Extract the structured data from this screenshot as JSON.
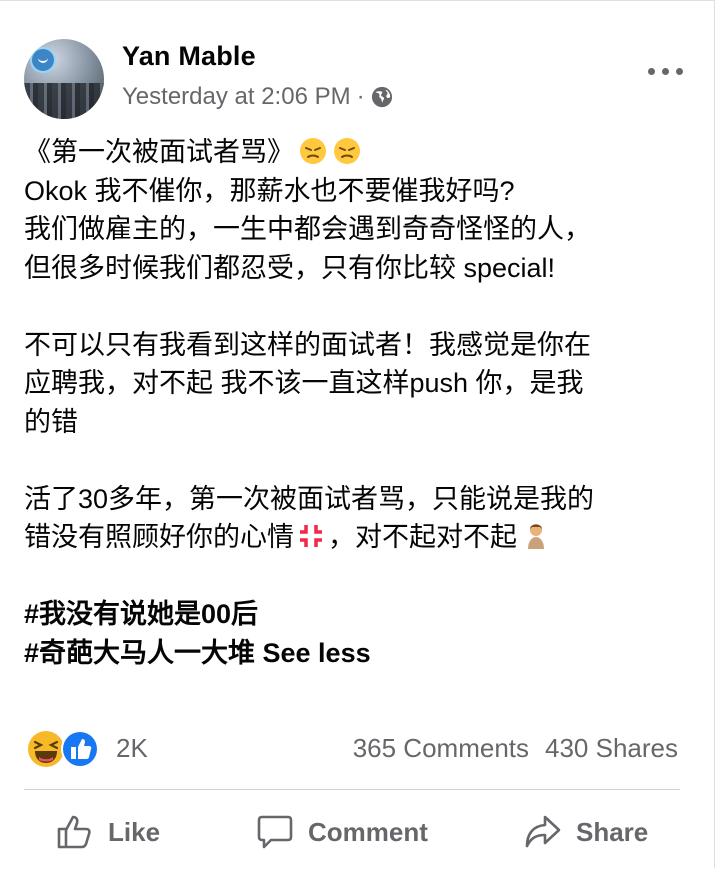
{
  "post": {
    "author": "Yan Mable",
    "timestamp": "Yesterday at 2:06 PM",
    "separator": "·",
    "audience_icon": "globe-icon",
    "more_icon": "more-options-icon",
    "lines": {
      "l1": "《第一次被面试者骂》",
      "l2": "Okok 我不催你，那薪水也不要催我好吗?",
      "l3": "我们做雇主的，一生中都会遇到奇奇怪怪的人，",
      "l4": "但很多时候我们都忍受，只有你比较 special!",
      "l5": "不可以只有我看到这样的面试者！我感觉是你在",
      "l6": "应聘我，对不起 我不该一直这样push 你，是我",
      "l7": "的错",
      "l8": "活了30多年，第一次被面试者骂，只能说是我的",
      "l9": "错没有照顾好你的心情",
      "l9b": "，对不起对不起",
      "l10": "#我没有说她是00后",
      "l11": "#奇葩大马人一大堆 See less"
    }
  },
  "reactions": {
    "icons": [
      "laughing-reaction-icon",
      "like-reaction-icon"
    ],
    "count": "2K",
    "comments": "365 Comments",
    "shares": "430 Shares"
  },
  "actions": {
    "like": "Like",
    "comment": "Comment",
    "share": "Share"
  },
  "colors": {
    "text": "#050505",
    "secondary": "#65676b",
    "like_blue": "#1877f2",
    "laugh_yellow": "#f7b928"
  }
}
